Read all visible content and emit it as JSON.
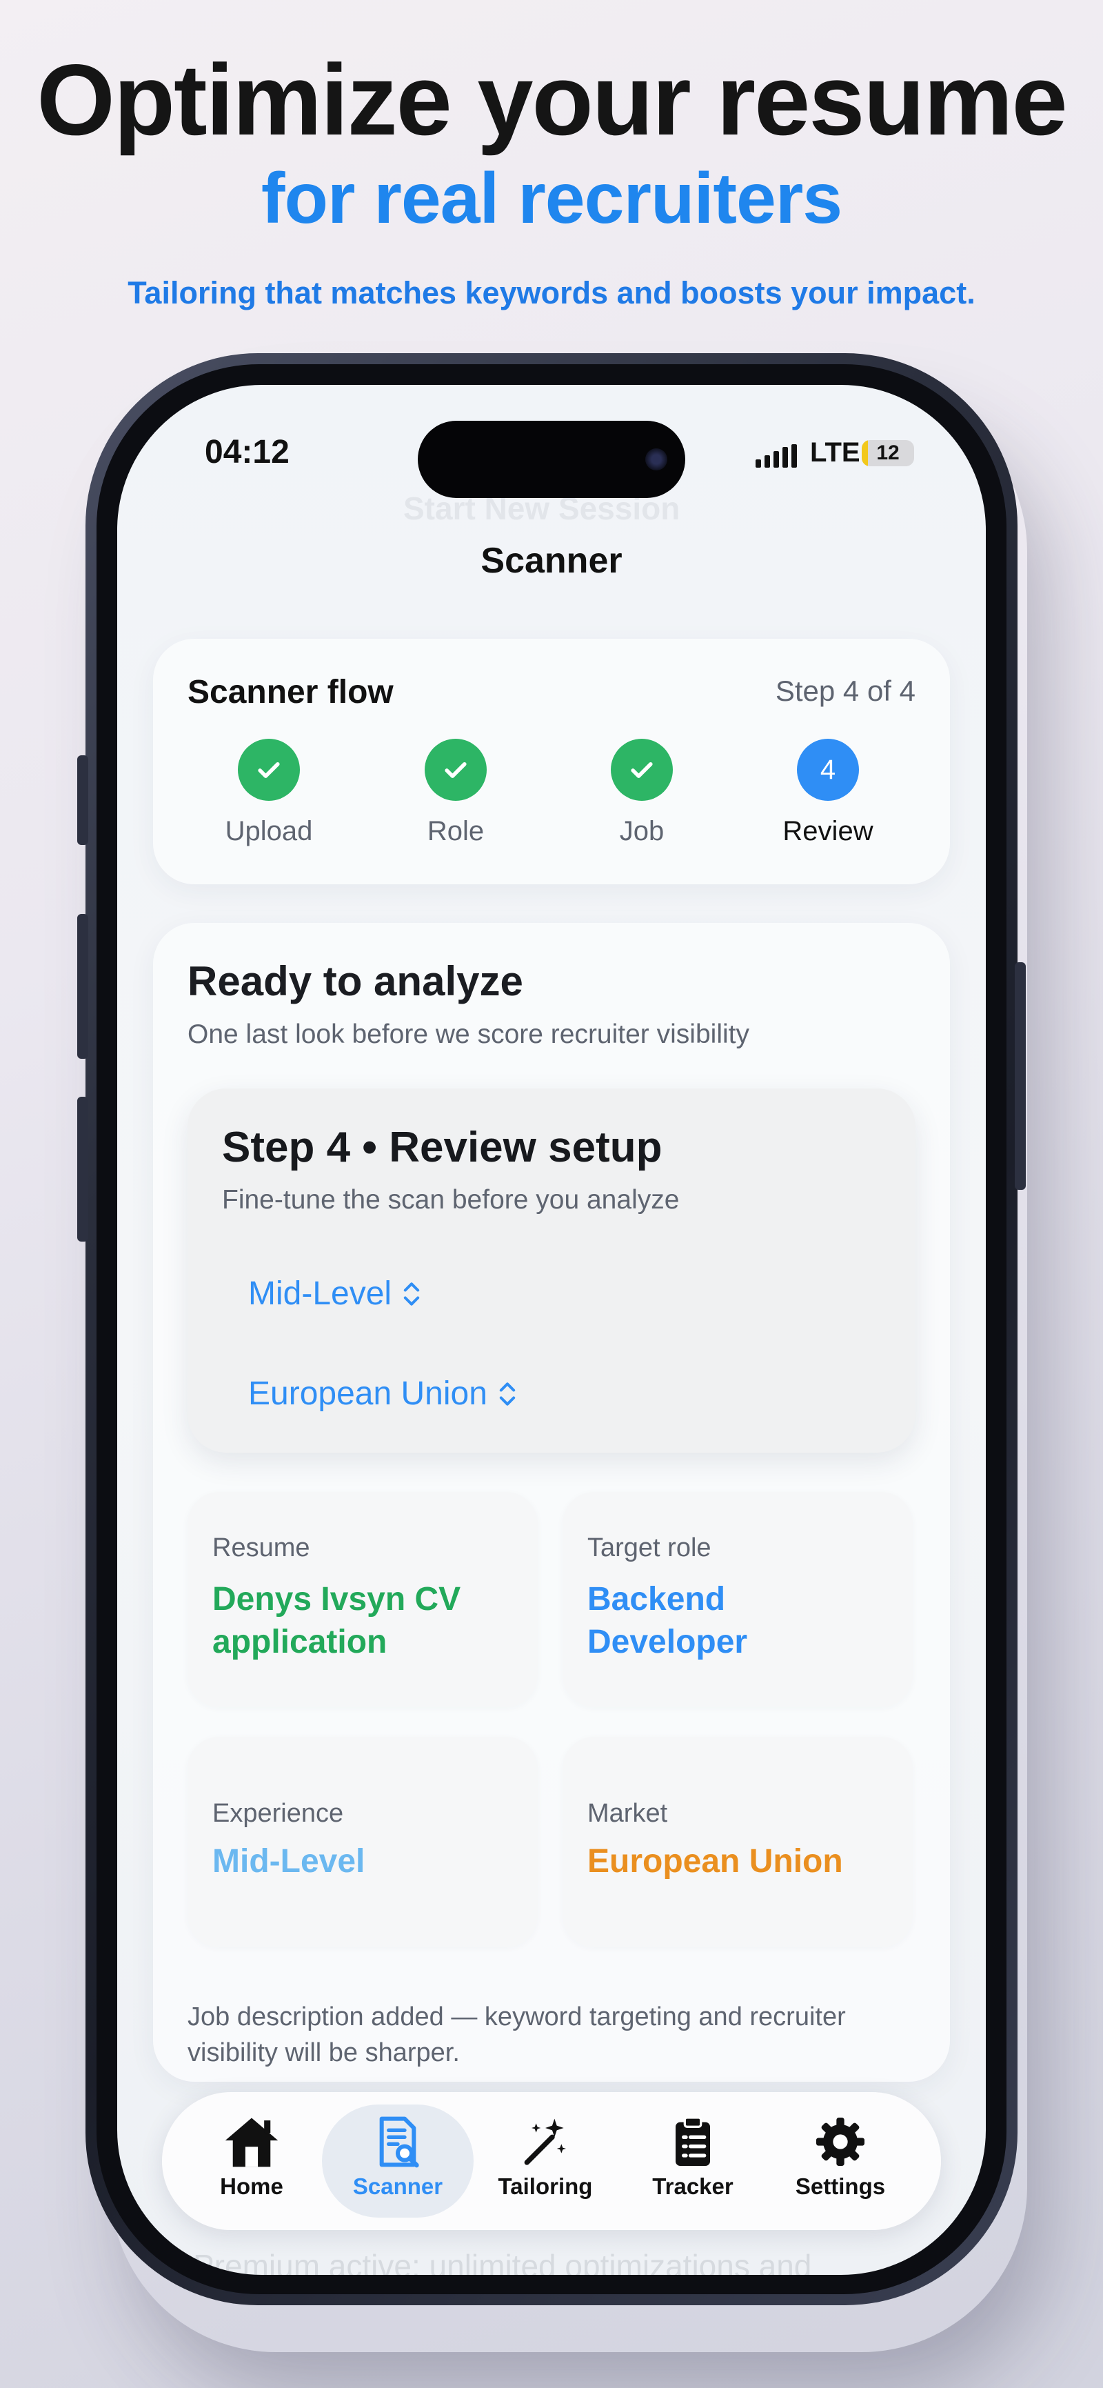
{
  "hero": {
    "title": "Optimize your resume",
    "subtitle": "for real recruiters",
    "tagline": "Tailoring that matches keywords and boosts your impact."
  },
  "status_bar": {
    "time": "04:12",
    "network": "LTE",
    "battery": "12"
  },
  "background_ghost": {
    "start_session": "Start New Session",
    "premium_note": "Premium active: unlimited optimizations and"
  },
  "nav": {
    "title": "Scanner"
  },
  "flow": {
    "title": "Scanner flow",
    "step_indicator": "Step 4 of 4",
    "steps": [
      {
        "label": "Upload",
        "state": "done",
        "icon": "checkmark-icon"
      },
      {
        "label": "Role",
        "state": "done",
        "icon": "checkmark-icon"
      },
      {
        "label": "Job",
        "state": "done",
        "icon": "checkmark-icon"
      },
      {
        "label": "Review",
        "state": "current",
        "number": "4"
      }
    ]
  },
  "main": {
    "title": "Ready to analyze",
    "subtitle": "One last look before we score recruiter visibility",
    "review": {
      "title": "Step 4 • Review setup",
      "subtitle": "Fine-tune the scan before you analyze",
      "experience_picker": "Mid-Level",
      "market_picker": "European Union"
    },
    "summary": [
      {
        "label": "Resume",
        "value": "Denys Ivsyn CV application",
        "color": "#22a95a"
      },
      {
        "label": "Target role",
        "value": "Backend Developer",
        "color": "#2f8ef5"
      },
      {
        "label": "Experience",
        "value": "Mid-Level",
        "color": "#6bb8f0"
      },
      {
        "label": "Market",
        "value": "European Union",
        "color": "#ea8f1f"
      }
    ],
    "note": "Job description added — keyword targeting and recruiter visibility will be sharper."
  },
  "tabs": [
    {
      "label": "Home",
      "icon": "home-icon"
    },
    {
      "label": "Scanner",
      "icon": "scanner-document-icon",
      "active": true
    },
    {
      "label": "Tailoring",
      "icon": "magic-wand-icon"
    },
    {
      "label": "Tracker",
      "icon": "clipboard-list-icon"
    },
    {
      "label": "Settings",
      "icon": "gear-icon"
    }
  ],
  "colors": {
    "accent": "#2f8ef5",
    "success": "#2db565",
    "hero_blue": "#1f86ee"
  }
}
